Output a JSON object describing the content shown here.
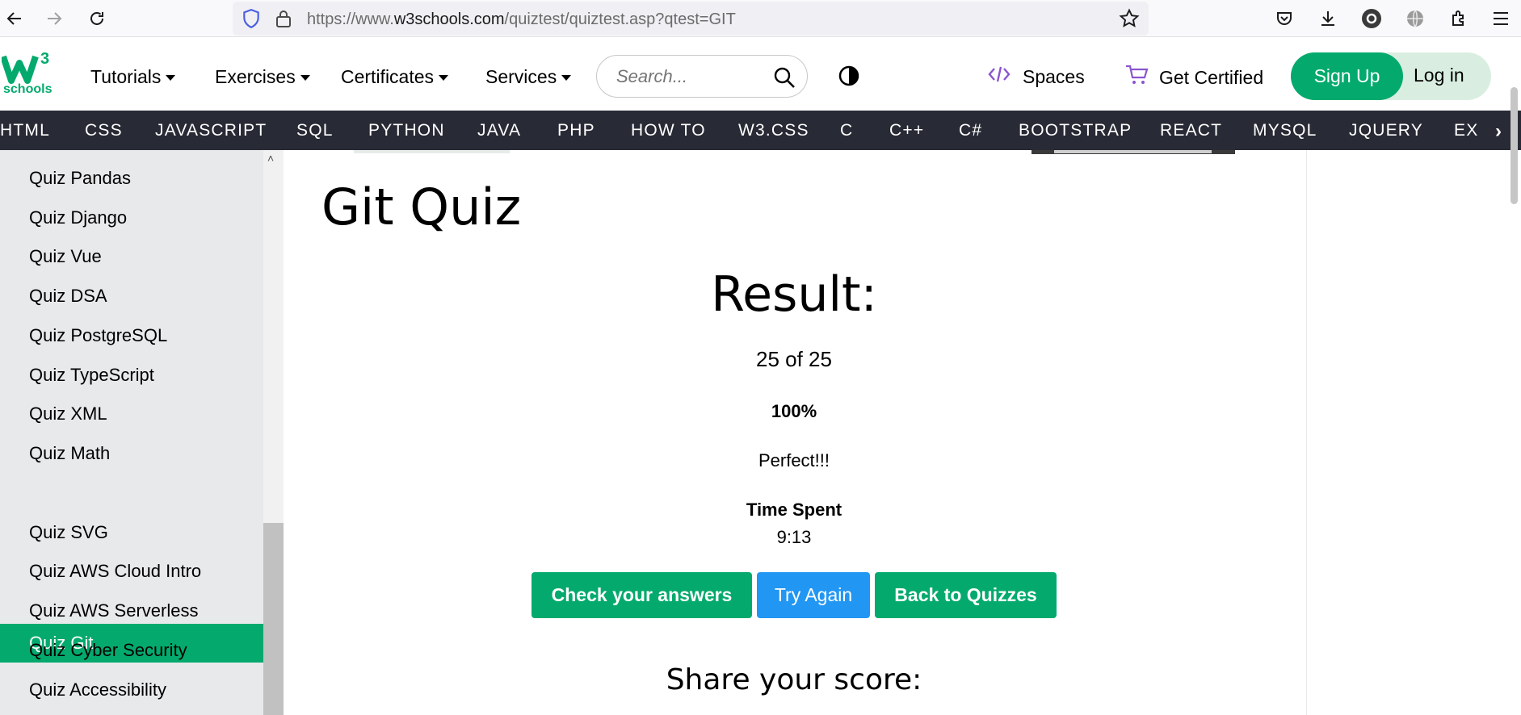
{
  "browser": {
    "url_prefix": "https://www.",
    "url_domain": "w3schools.com",
    "url_path": "/quiztest/quiztest.asp?qtest=GIT"
  },
  "header": {
    "logo_number": "3",
    "logo_text": "schools",
    "menu": [
      "Tutorials",
      "Exercises",
      "Certificates",
      "Services"
    ],
    "search_placeholder": "Search...",
    "spaces_label": "Spaces",
    "get_certified_label": "Get Certified",
    "signup_label": "Sign Up",
    "login_label": "Log in"
  },
  "subnav": {
    "items": [
      "HTML",
      "CSS",
      "JAVASCRIPT",
      "SQL",
      "PYTHON",
      "JAVA",
      "PHP",
      "HOW TO",
      "W3.CSS",
      "C",
      "C++",
      "C#",
      "BOOTSTRAP",
      "REACT",
      "MYSQL",
      "JQUERY",
      "EX"
    ]
  },
  "sidebar": {
    "items": [
      "Quiz Pandas",
      "Quiz Django",
      "Quiz Vue",
      "Quiz DSA",
      "Quiz PostgreSQL",
      "Quiz TypeScript",
      "Quiz XML",
      "Quiz Math",
      "Quiz Git",
      "Quiz SVG",
      "Quiz AWS Cloud Intro",
      "Quiz AWS Serverless",
      "Quiz Cyber Security",
      "Quiz Accessibility"
    ],
    "active_index": 8
  },
  "main": {
    "title": "Git Quiz",
    "result_heading": "Result:",
    "score": "25 of 25",
    "percent": "100%",
    "message": "Perfect!!!",
    "time_label": "Time Spent",
    "time_value": "9:13",
    "buttons": {
      "check": "Check your answers",
      "try_again": "Try Again",
      "back": "Back to Quizzes"
    },
    "share_heading": "Share your score:"
  },
  "colors": {
    "brand_green": "#04aa6d",
    "try_blue": "#2196f3",
    "subnav_bg": "#282a35",
    "sidebar_bg": "#e7e9eb"
  }
}
